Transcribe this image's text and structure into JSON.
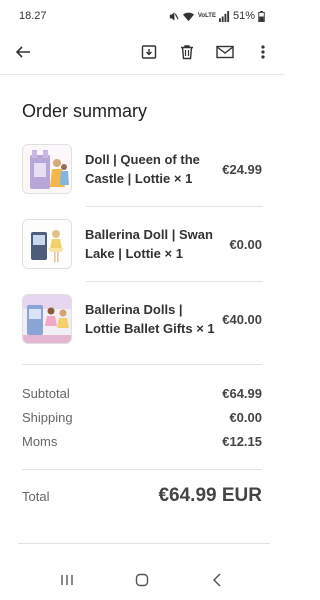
{
  "status_bar": {
    "time": "18.27",
    "network_label": "VoLTE",
    "battery_percent": "51%",
    "icons": [
      "mute-icon",
      "wifi-icon",
      "volte-icon",
      "signal-icon",
      "battery-icon"
    ]
  },
  "toolbar": {
    "icons": [
      "back-arrow-icon",
      "archive-icon",
      "delete-icon",
      "mail-icon",
      "more-vert-icon"
    ]
  },
  "order": {
    "title": "Order summary",
    "items": [
      {
        "name": "Doll | Queen of the Castle | Lottie × 1",
        "price": "€24.99",
        "thumb_icon": "doll-castle-image"
      },
      {
        "name": "Ballerina Doll | Swan Lake | Lottie × 1",
        "price": "€0.00",
        "thumb_icon": "ballerina-doll-image"
      },
      {
        "name": "Ballerina Dolls | Lottie Ballet Gifts × 1",
        "price": "€40.00",
        "thumb_icon": "ballerina-dolls-image"
      }
    ],
    "subtotal_label": "Subtotal",
    "subtotal_value": "€64.99",
    "shipping_label": "Shipping",
    "shipping_value": "€0.00",
    "tax_label": "Moms",
    "tax_value": "€12.15",
    "total_label": "Total",
    "total_value": "€64.99 EUR"
  },
  "navbar": {
    "icons": [
      "recents-icon",
      "home-icon",
      "back-icon"
    ]
  }
}
